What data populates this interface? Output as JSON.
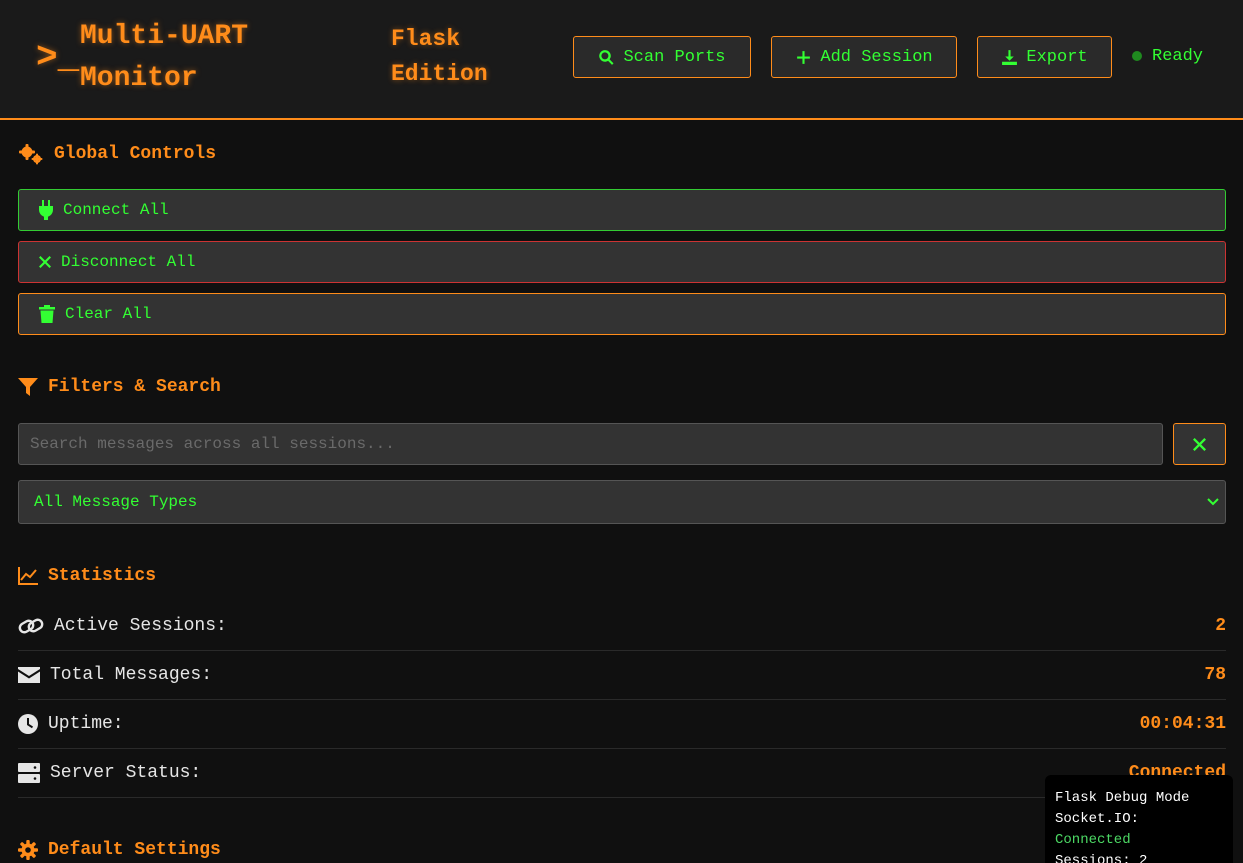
{
  "header": {
    "logo_glyph": ">_",
    "title": "Multi-UART Monitor",
    "subtitle": "Flask Edition",
    "buttons": {
      "scan": "Scan Ports",
      "add": "Add Session",
      "export": "Export"
    },
    "status": "Ready"
  },
  "global_controls": {
    "title": "Global Controls",
    "connect_all": "Connect All",
    "disconnect_all": "Disconnect All",
    "clear_all": "Clear All"
  },
  "filters": {
    "title": "Filters & Search",
    "search_placeholder": "Search messages across all sessions...",
    "search_value": "",
    "message_type_selected": "All Message Types"
  },
  "statistics": {
    "title": "Statistics",
    "rows": [
      {
        "label": "Active Sessions:",
        "value": "2",
        "icon": "link-icon"
      },
      {
        "label": "Total Messages:",
        "value": "78",
        "icon": "envelope-icon"
      },
      {
        "label": "Uptime:",
        "value": "00:04:31",
        "icon": "clock-icon"
      },
      {
        "label": "Server Status:",
        "value": "Connected",
        "icon": "server-icon"
      }
    ]
  },
  "default_settings": {
    "title": "Default Settings"
  },
  "debug_panel": {
    "mode": "Flask Debug Mode",
    "socket_label": "Socket.IO:",
    "socket_status": "Connected",
    "sessions_label": "Sessions:",
    "sessions_count": "2"
  },
  "colors": {
    "accent": "#ff8c1a",
    "text_green": "#33ff33",
    "background": "#101010",
    "connect_border": "#33cc33",
    "disconnect_border": "#cc3333"
  }
}
